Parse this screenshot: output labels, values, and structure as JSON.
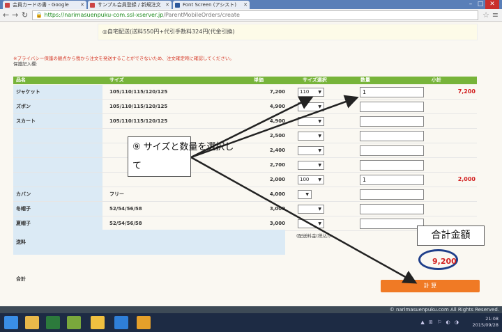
{
  "browser": {
    "tabs": [
      {
        "label": "会員カードの書 - Google"
      },
      {
        "label": "サンプル会員登録 / 新規注文"
      },
      {
        "label": "Font Screen (アシスト)"
      }
    ],
    "url_host": "https://narimasuenpuku-com.ssl-xserver.jp",
    "url_path": "/ParentMobileOrders/create"
  },
  "page": {
    "shipping_notice": "◎自宅配送(送料550円+代引手数料324円(代金引換)",
    "warning": "※プライバシー保護の観点から我から注文を発送することができないため、注文確定時に確認してください。",
    "note": "保護記入欄:",
    "columns": {
      "name": "品名",
      "size": "サイズ",
      "unit_price": "単価",
      "size_select": "サイズ選択",
      "quantity": "数量",
      "subtotal": "小計"
    },
    "rows": [
      {
        "name": "ジャケット",
        "sizes": "105/110/115/120/125",
        "price": "7,200",
        "selected": "110",
        "qty": "1",
        "subtotal": "7,200"
      },
      {
        "name": "ズボン",
        "sizes": "105/110/115/120/125",
        "price": "4,900",
        "selected": "",
        "qty": "",
        "subtotal": ""
      },
      {
        "name": "スカート",
        "sizes": "105/110/115/120/125",
        "price": "4,900",
        "selected": "",
        "qty": "",
        "subtotal": ""
      },
      {
        "name": "",
        "sizes": "",
        "price": "2,500",
        "selected": "",
        "qty": "",
        "subtotal": ""
      },
      {
        "name": "",
        "sizes": "",
        "price": "2,400",
        "selected": "",
        "qty": "",
        "subtotal": ""
      },
      {
        "name": "",
        "sizes": "",
        "price": "2,700",
        "selected": "",
        "qty": "",
        "subtotal": ""
      },
      {
        "name": "",
        "sizes": "",
        "price": "2,000",
        "selected": "100",
        "qty": "1",
        "subtotal": "2,000"
      },
      {
        "name": "カバン",
        "sizes": "フリー",
        "price": "4,000",
        "selected": "",
        "qty": "",
        "subtotal": ""
      },
      {
        "name": "冬帽子",
        "sizes": "52/54/56/58",
        "price": "3,000",
        "selected": "",
        "qty": "",
        "subtotal": ""
      },
      {
        "name": "夏帽子",
        "sizes": "52/54/56/58",
        "price": "3,000",
        "selected": "",
        "qty": "",
        "subtotal": ""
      }
    ],
    "shipping_label": "送料",
    "shipping_tip": "(配送料金(税込))",
    "total_label": "合計",
    "total_value": "9,200",
    "submit_label": "計 算",
    "copyright": "© narimasuenpuku.com All Rights Reserved."
  },
  "annotations": {
    "callout_line1": "⑨ サイズと数量を選択し",
    "callout_line2": "て",
    "total_callout": "合計金額"
  },
  "taskbar": {
    "time": "21:08",
    "date": "2015/09/28"
  },
  "colors": {
    "header_green": "#77b43a",
    "accent_red": "#d21f1f",
    "submit_orange": "#f07a25",
    "oval_blue": "#1f3f8a"
  }
}
